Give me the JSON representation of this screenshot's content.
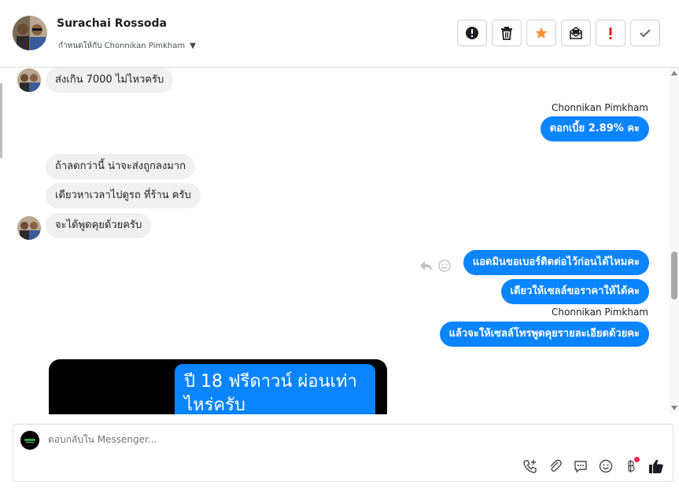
{
  "header": {
    "name": "Surachai Rossoda",
    "assigned_label": "กำหนดให้กับ Chonnikan Pimkham"
  },
  "toolbar": {
    "buttons": [
      "alert-icon",
      "trash-icon",
      "star-icon",
      "mail-icon",
      "exclamation-icon",
      "check-icon"
    ],
    "star_color": "#f7923a",
    "exclamation_color": "#e02020"
  },
  "messages": {
    "m1": "ส่งเกิน 7000 ไม่ไหวครับ",
    "sender1": "Chonnikan Pimkham",
    "m2": "ดอกเบี้ย 2.89% คะ",
    "m3": "ถ้าลดกว่านี้ น่าจะส่งถูกลงมาก",
    "m4": "เดียวหาเวลาไปดูรถ ที่ร้าน ครับ",
    "m5": "จะได้พูดคุยด้วยครับ",
    "m6": "แอดมินขอเบอร์ติดต่อไว้ก่อนได้ไหมคะ",
    "m7": "เดียวให้เซลล์ขอราคาให้ได้คะ",
    "sender2": "Chonnikan Pimkham",
    "m8": "แล้วจะให้เซลล์โทรพูดคุยรายละเอียดด้วยคะ",
    "photo_text": "ปี 18 ฟรีดาวน์ ผ่อนเท่าไหร่ครับ"
  },
  "colors": {
    "outgoing_bubble": "#0a84ff",
    "incoming_bubble": "#f1f0f0"
  },
  "composer": {
    "placeholder": "ตอบกลับใน Messenger..."
  }
}
